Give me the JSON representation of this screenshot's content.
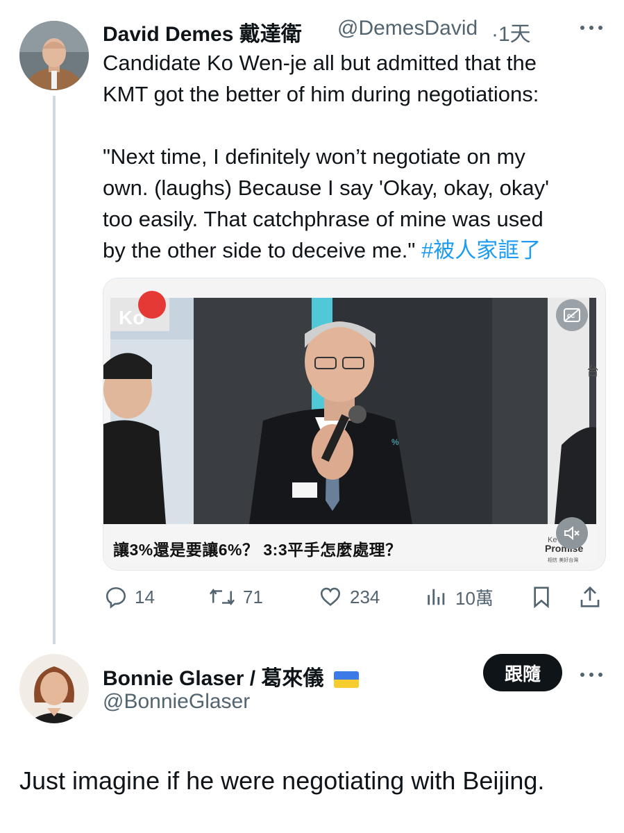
{
  "tweet": {
    "author_name": "David Demes 戴達衛",
    "handle": "@DemesDavid",
    "time": "·1天",
    "text_line1": "Candidate Ko Wen-je all but admitted that the",
    "text_line2": "KMT got the better of him during negotiations:",
    "quote_line1": "\"Next time, I definitely won’t negotiate on my",
    "quote_line2": "own. (laughs) Because I say 'Okay, okay, okay'",
    "quote_line3": "too easily. That catchphrase of mine was used",
    "quote_line4": "by the other side to deceive me.\"",
    "hashtag": "#被人家誆了",
    "more_icon": "more-dots-icon"
  },
  "media": {
    "caption": "讓3%還是要讓6%？ 3:3平手怎麼處理？",
    "brand_text": "Promise",
    "brand_sub": "相信 美好台灣",
    "corner_char": "台",
    "logo_text": "Ko",
    "pin_text": "%"
  },
  "actions": {
    "replies": "14",
    "retweets": "71",
    "likes": "234",
    "views": "10萬"
  },
  "reply": {
    "author_name": "Bonnie Glaser / 葛來儀",
    "handle": "@BonnieGlaser",
    "follow_label": "跟隨",
    "text": "Just imagine if he were negotiating with Beijing."
  },
  "colors": {
    "accent": "#1d9bf0",
    "text": "#0f1419",
    "muted": "#536471",
    "button": "#0f1419"
  }
}
